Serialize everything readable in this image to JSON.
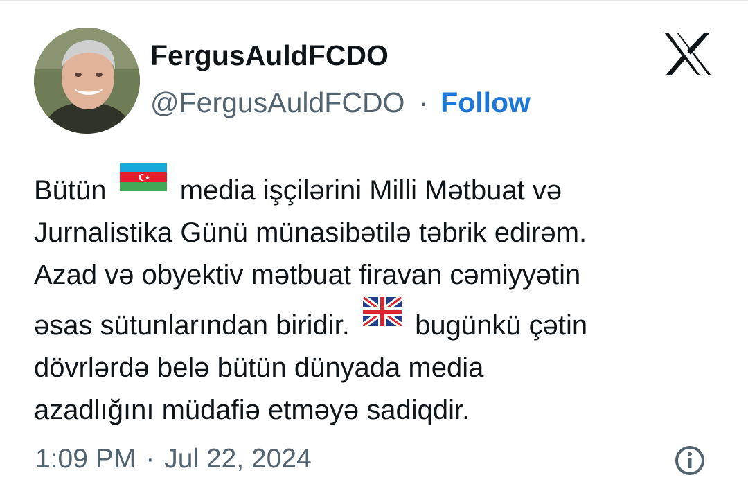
{
  "author": {
    "display_name": "FergusAuldFCDO",
    "handle": "@FergusAuldFCDO",
    "separator": "·",
    "follow_label": "Follow"
  },
  "tweet": {
    "line1_start": "Bütün",
    "line1_end": "media işçilərini Milli Mətbuat və",
    "line2": "Jurnalistika Günü münasibətilə təbrik edirəm.",
    "line3": "Azad və obyektiv mətbuat firavan cəmiyyətin",
    "line4_start": "əsas sütunlarından biridir.",
    "line4_end": "bugünkü çətin",
    "line5": "dövrlərdə belə bütün dünyada media",
    "line6": "azadlığını müdafiə etməyə sadiqdir.",
    "flag1": "azerbaijan-flag",
    "flag2": "united-kingdom-flag"
  },
  "meta": {
    "time": "1:09 PM",
    "separator": "·",
    "date": "Jul 22, 2024"
  },
  "icons": {
    "platform": "x-logo-icon",
    "info": "info-icon"
  },
  "colors": {
    "follow": "#1d77d8",
    "secondary_text": "#536471",
    "primary_text": "#0f1419"
  }
}
